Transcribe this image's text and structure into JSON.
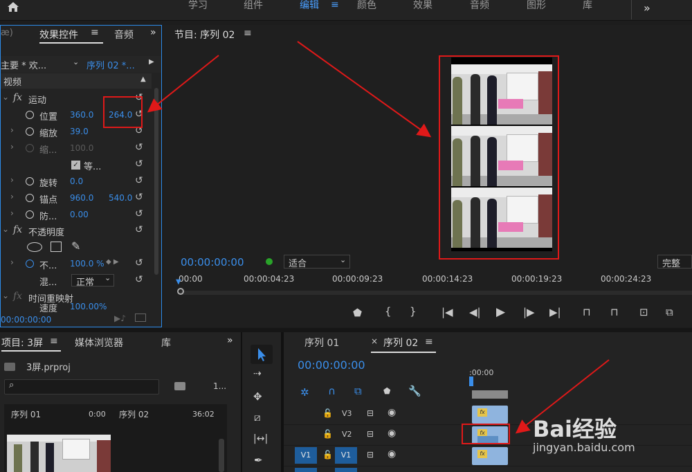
{
  "topbar": {
    "tabs": [
      {
        "label": "学习"
      },
      {
        "label": "组件"
      },
      {
        "label": "编辑"
      },
      {
        "label": "颜色"
      },
      {
        "label": "效果"
      },
      {
        "label": "音频"
      },
      {
        "label": "图形"
      },
      {
        "label": "库"
      }
    ]
  },
  "effects": {
    "tab_label": "效果控件",
    "tab_audio": "音频",
    "source_label": "主要 * 欢...",
    "sequence_label": "序列 02 *...",
    "section_video": "视频",
    "motion_label": "运动",
    "position_label": "位置",
    "position_x": "360.0",
    "position_y": "264.0",
    "scale_label": "缩放",
    "scale_value": "39.0",
    "scale_w_label": "缩...",
    "scale_w_value": "100.0",
    "uniform_label": "等...",
    "rotation_label": "旋转",
    "rotation_value": "0.0",
    "anchor_label": "锚点",
    "anchor_x": "960.0",
    "anchor_y": "540.0",
    "anti_flicker_label": "防...",
    "anti_flicker_value": "0.00",
    "opacity_label": "不透明度",
    "opacity_sub_label": "不...",
    "opacity_value": "100.0 %",
    "blend_label": "混...",
    "blend_value": "正常",
    "time_remap_label": "时间重映射",
    "speed_label": "速度",
    "speed_value": "100.00%",
    "timecode": "00:00:00:00"
  },
  "program": {
    "title": "节目: 序列 02",
    "timecode": "00:00:00:00",
    "fit": "适合",
    "quality": "完整",
    "ruler": [
      "00:00",
      "00:00:04:23",
      "00:00:09:23",
      "00:00:14:23",
      "00:00:19:23",
      "00:00:24:23"
    ]
  },
  "project": {
    "tab_project": "项目: 3屏",
    "tab_media": "媒体浏览器",
    "tab_lib": "库",
    "file": "3屏.prproj",
    "count": "1...",
    "items": [
      {
        "name": "序列 01",
        "duration": "0:00"
      },
      {
        "name": "序列 02",
        "duration": "36:02"
      }
    ]
  },
  "sequence": {
    "tab1": "序列 01",
    "tab2": "序列 02",
    "timecode": "00:00:00:00",
    "ruler_start": ":00:00",
    "tracks": [
      {
        "name": "V3"
      },
      {
        "name": "V2"
      },
      {
        "name": "V1",
        "source": "V1"
      }
    ],
    "clip_fx": "fx"
  },
  "watermark": {
    "brand": "Bai经验",
    "url": "jingyan.baidu.com"
  },
  "colors": {
    "accent": "#2d8ceb",
    "annotation": "#e01919",
    "clip": "#8fb4de",
    "fx_badge": "#e5c44b"
  }
}
